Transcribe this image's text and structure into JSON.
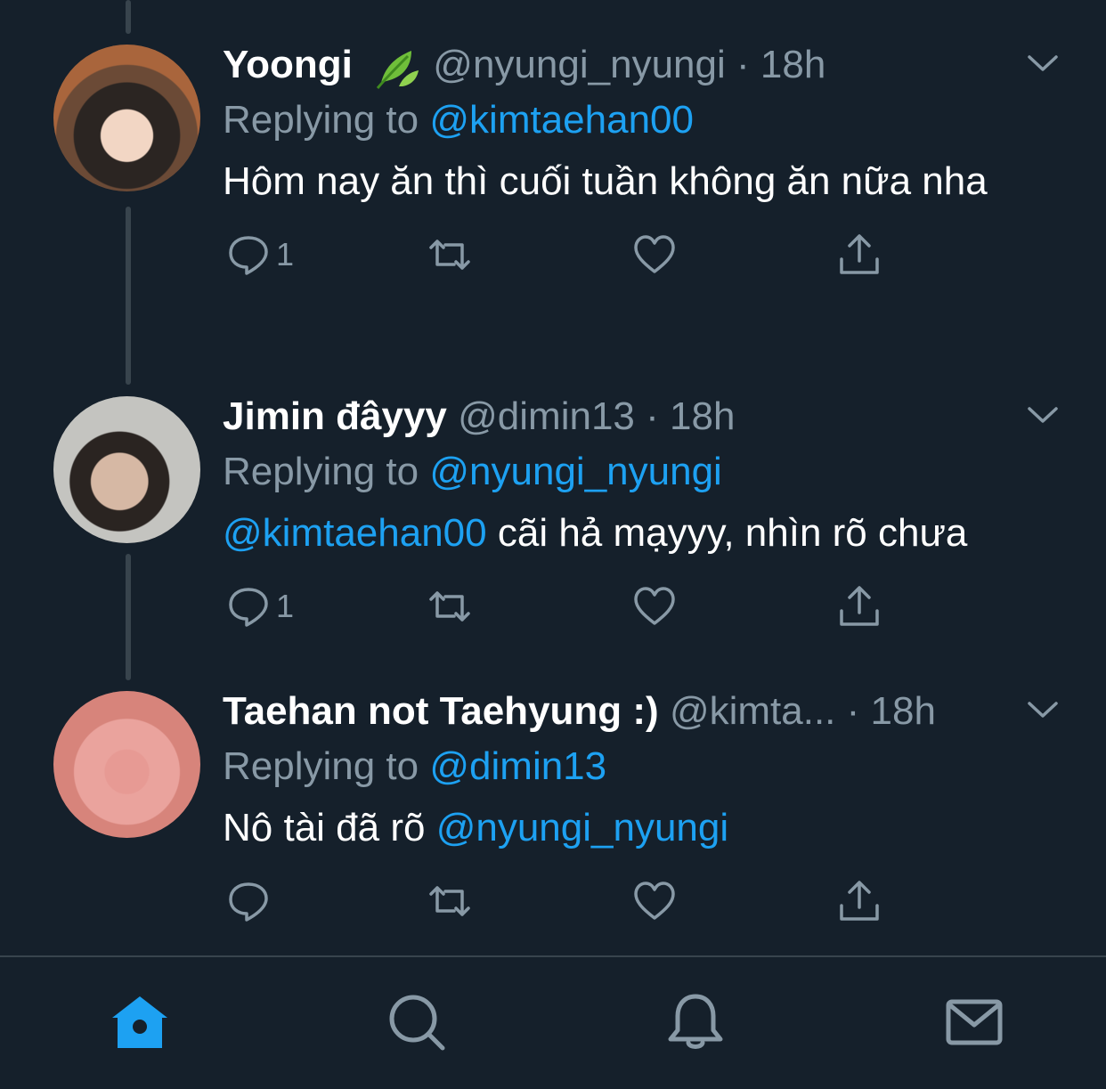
{
  "colors": {
    "background": "#15202b",
    "accent": "#1da1f2",
    "muted": "#8899a6",
    "divider": "#38444d"
  },
  "tweets": [
    {
      "name": "Yoongi",
      "name_icon": "leaf-emoji-icon",
      "handle": "@nyungi_nyungi",
      "time": "18h",
      "replying_label": "Replying to",
      "replying_to": "@kimtaehan00",
      "text": "Hôm nay ăn thì cuối tuần không ăn nữa nha",
      "mention_prefix": "",
      "reply_count": "1"
    },
    {
      "name": "Jimin đâyyy",
      "handle": "@dimin13",
      "time": "18h",
      "replying_label": "Replying to",
      "replying_to": "@nyungi_nyungi",
      "mention_prefix": "@kimtaehan00",
      "text": " cãi hả mạyyy, nhìn rõ chưa",
      "reply_count": "1"
    },
    {
      "name": "Taehan not Taehyung :)",
      "handle": "@kimta...",
      "time": "18h",
      "replying_label": "Replying to",
      "replying_to": "@dimin13",
      "text": "Nô tài đã rõ ",
      "mention_suffix": "@nyungi_nyungi",
      "reply_count": ""
    }
  ],
  "tabbar": {
    "items": [
      "home-icon",
      "search-icon",
      "notifications-icon",
      "messages-icon"
    ],
    "active": "home-icon"
  }
}
